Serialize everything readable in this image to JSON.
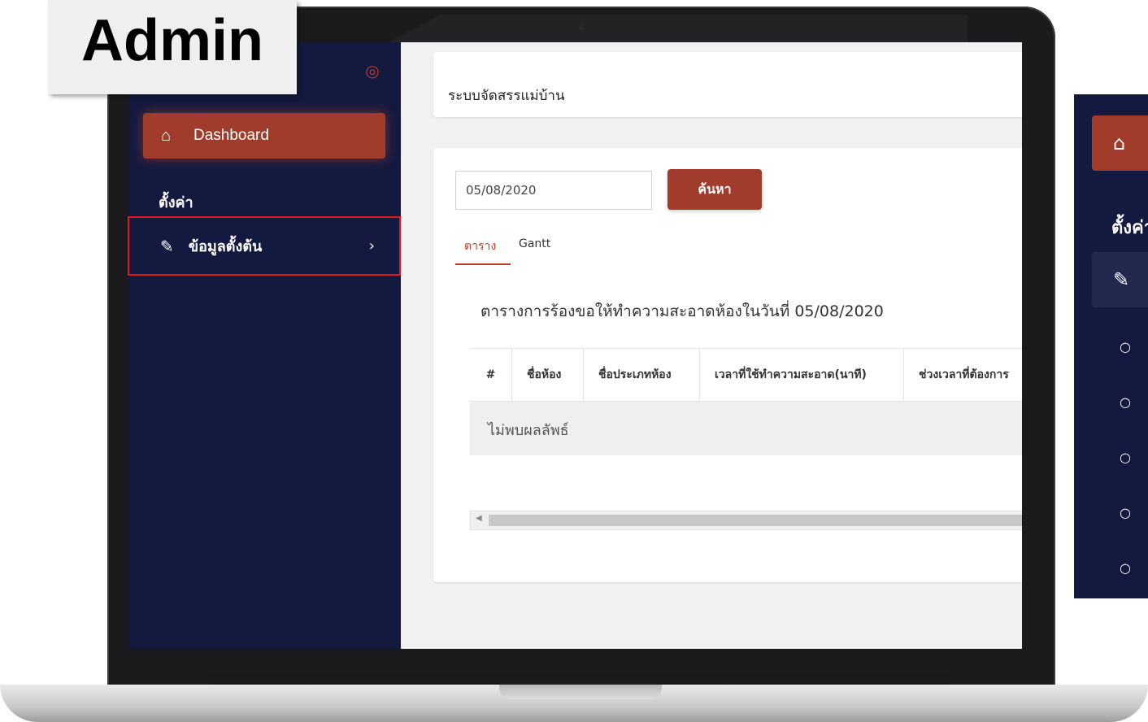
{
  "overlay": {
    "label": "Admin"
  },
  "sidebar": {
    "collapse_icon": "target-icon",
    "active_item": {
      "label": "Dashboard",
      "icon": "home-icon"
    },
    "section_title": "ตั้งค่า",
    "items": [
      {
        "label": "ข้อมูลตั้งต้น",
        "icon": "edit-icon",
        "chevron": "›"
      }
    ]
  },
  "header": {
    "title": "ระบบจัดสรรแม่บ้าน"
  },
  "search": {
    "date_value": "05/08/2020",
    "button_label": "ค้นหา"
  },
  "tabs": [
    {
      "label": "ตาราง",
      "active": true
    },
    {
      "label": "Gantt",
      "active": false
    }
  ],
  "table": {
    "title": "ตารางการร้องขอให้ทำความสะอาดห้องในวันที่ 05/08/2020",
    "columns": [
      "#",
      "ชื่อห้อง",
      "ชื่อประเภทห้อง",
      "เวลาที่ใช้ทำความสะอาด(นาที)",
      "ช่วงเวลาที่ต้องการ"
    ],
    "empty_text": "ไม่พบผลลัพธ์"
  },
  "zoom_panel": {
    "home_icon": "⌂",
    "section_title": "ตั้งค่า",
    "edit_icon": "✎",
    "dot": "○"
  },
  "colors": {
    "sidebar_bg": "#141a3f",
    "accent": "#a13c2c",
    "highlight_border": "#e3161c"
  }
}
